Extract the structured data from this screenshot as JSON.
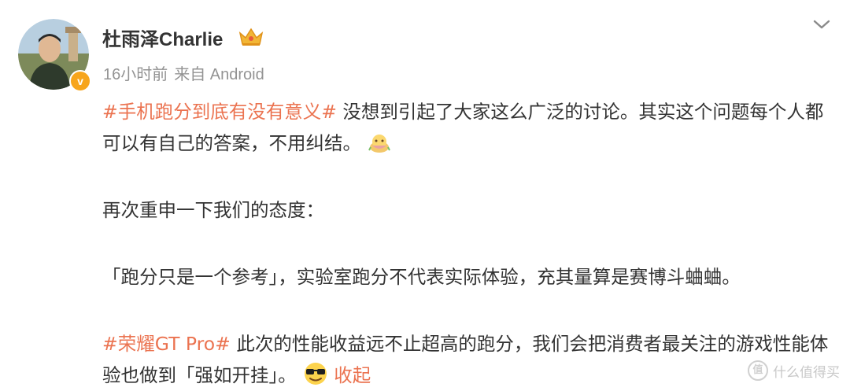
{
  "author": {
    "name": "杜雨泽Charlie",
    "verified_badge": "v",
    "crown_icon": "crown-icon"
  },
  "meta": {
    "time": "16小时前",
    "source": "来自 Android"
  },
  "post": {
    "p1": {
      "hashtag": "#手机跑分到底有没有意义#",
      "text": " 没想到引起了大家这么广泛的讨论。其实这个问题每个人都可以有自己的答案，不用纠结。"
    },
    "p2": "再次重申一下我们的态度：",
    "p3": "「跑分只是一个参考」，实验室跑分不代表实际体验，充其量算是赛博斗蛐蛐。",
    "p4": {
      "hashtag": "#荣耀GT Pro#",
      "text": " 此次的性能收益远不止超高的跑分，我们会把消费者最关注的游戏性能体验也做到「强如开挂」。",
      "collapse": "收起"
    }
  },
  "watermark": {
    "icon": "值",
    "text": "什么值得买"
  },
  "colors": {
    "accent": "#eb7350",
    "meta": "#939393",
    "text": "#333333",
    "badge": "#f7a51c"
  }
}
